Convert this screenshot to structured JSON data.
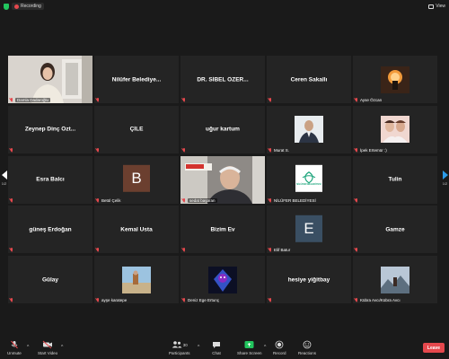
{
  "window": {
    "recording_label": "Recording",
    "view_label": "View"
  },
  "participants": [
    {
      "name": "Damla Dadaroğlu",
      "type": "video",
      "active": true
    },
    {
      "name": "Nilüfer Belediye...",
      "type": "name"
    },
    {
      "name": "DR. SİBEL ÖZER...",
      "type": "name"
    },
    {
      "name": "Ceren Sakallı",
      "type": "name"
    },
    {
      "name": "Ayse Özcan",
      "type": "photo"
    },
    {
      "name": "Zeynep Dinç Özt...",
      "type": "name"
    },
    {
      "name": "ÇİLE",
      "type": "name"
    },
    {
      "name": "uğur kartum",
      "type": "name"
    },
    {
      "name": "Murat S.",
      "type": "photo"
    },
    {
      "name": "İpek Ertemür :)",
      "type": "photo"
    },
    {
      "name": "Esra Balcı",
      "type": "name"
    },
    {
      "name": "Betül Çelik",
      "type": "letter",
      "letter": "B"
    },
    {
      "name": "sedat başaran",
      "type": "video"
    },
    {
      "name": "NİLÜFER BELEDİYESİ",
      "type": "logo"
    },
    {
      "name": "Tulin",
      "type": "name"
    },
    {
      "name": "güneş Erdoğan",
      "type": "name"
    },
    {
      "name": "Kemal Usta",
      "type": "name"
    },
    {
      "name": "Bizim Ev",
      "type": "name"
    },
    {
      "name": "Elif Batur",
      "type": "letter",
      "letter": "E"
    },
    {
      "name": "Gamze",
      "type": "name"
    },
    {
      "name": "Gülay",
      "type": "name"
    },
    {
      "name": "ayşe karatepe",
      "type": "photo"
    },
    {
      "name": "Deniz Ege Ertunç",
      "type": "photo"
    },
    {
      "name": "hesiye yiğitbay",
      "type": "name"
    },
    {
      "name": "Kübra Avcı/Kübra Avcı",
      "type": "photo"
    }
  ],
  "logo_text": "NİLÜFER BELEDİYESİ",
  "pagination": {
    "left": "1/2",
    "right": "1/2"
  },
  "toolbar": {
    "unmute": "Unmute",
    "start_video": "Start Video",
    "participants": "Participants",
    "participants_count": "30",
    "chat": "Chat",
    "share_screen": "Share Screen",
    "record": "Record",
    "reactions": "Reactions",
    "leave": "Leave"
  },
  "colors": {
    "accent_green": "#a3d900",
    "leave_red": "#e5484d",
    "share_green": "#22c55e",
    "letter_b_bg": "#6b3f2f",
    "letter_e_bg": "#3a4f63"
  }
}
